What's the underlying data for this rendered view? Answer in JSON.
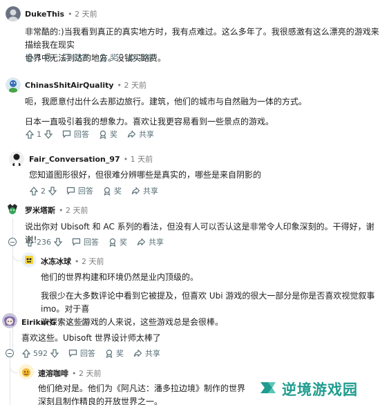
{
  "labels": {
    "reply": "回答",
    "award": "奖",
    "share": "共享"
  },
  "comments": [
    {
      "user": "DukeThis",
      "time": "• 2 天前",
      "body": [
        "非常酷的:)当我看到真正的真实地方时，我有点难过。这么多年了。我很感激有这么漂亮的游戏来描绘我在现实",
        "世界中无法到达的地方。没钱买路费。"
      ],
      "votes": "1"
    },
    {
      "user": "ChinasShitAirQuality",
      "time": "• 2 天前",
      "body": [
        "呃，我愿意付出什么去那边旅行。建筑，他们的城市与自然融为一体的方式。",
        "日本一直吸引着我的想象力。喜欢让我更容易看到一些景点的游戏。"
      ],
      "votes": "1"
    },
    {
      "user": "Fair_Conversation_97",
      "time": "• 1 天前",
      "body": [
        "您知道图形很好，但很难分辨哪些是真实的，哪些是来自阴影的"
      ],
      "votes": "2"
    },
    {
      "user": "罗米塔斯",
      "time": "• 2 天前",
      "body": [
        "说出你对 Ubisoft 和 AC 系列的看法，但没有人可以否认这是非常令人印象深刻的。干得好，谢谢！"
      ],
      "votes": "236"
    },
    {
      "user": "冰冻冰球",
      "time": "• 2 天前",
      "body": [
        "他们的世界构建和环境仍然是业内顶级的。",
        "我很少在大多数评论中看到它被提及，但喜欢 Ubi 游戏的很大一部分是你是否喜欢视觉叙事 imo。对于喜",
        "欢探索这些游戏的人来说，这些游戏总是会很棒。"
      ]
    },
    {
      "user": "EirikurG",
      "time": "• 2 天前",
      "body": [
        "喜欢这些。Ubisoft 世界设计师太棒了"
      ],
      "votes": "592"
    },
    {
      "user": "速溶咖啡",
      "time": "• 2 天前",
      "body": [
        "他们绝对是。他们为《阿凡达：潘多拉边境》制作的世界很容易",
        "深刻且制作精良的开放世界之一。"
      ]
    }
  ],
  "watermark": {
    "text": "逆境游戏园"
  },
  "colors": {
    "accent": "#1f9c8e",
    "meta": "#7c7c7c",
    "action": "#576f76"
  }
}
